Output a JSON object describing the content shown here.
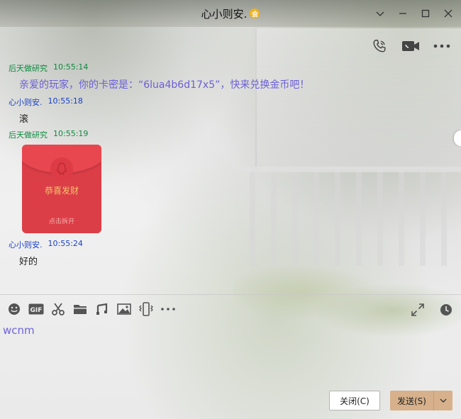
{
  "window": {
    "title": "心小则安.",
    "vip_badge": "会"
  },
  "messages": [
    {
      "sender": "后天做研究",
      "time": "10:55:14",
      "text": "亲爱的玩家，你的卡密是：“6lua4b6d17x5”，快来兑换金币吧！"
    },
    {
      "sender": "心小则安.",
      "time": "10:55:18",
      "text": "滚"
    },
    {
      "sender": "后天做研究",
      "time": "10:55:19",
      "red_packet": {
        "title": "恭喜发财",
        "action": "点击拆开"
      }
    },
    {
      "sender": "心小则安.",
      "time": "10:55:24",
      "text": "好的"
    }
  ],
  "input": {
    "value": "wcnm"
  },
  "buttons": {
    "close": "关闭(C)",
    "send": "发送(S)"
  },
  "icons": {
    "call": "phone-icon",
    "video": "video-icon",
    "more": "more-icon",
    "emoji": "emoji-icon",
    "gif": "gif-icon",
    "screenshot": "scissors-icon",
    "file": "folder-icon",
    "music": "music-icon",
    "image": "image-icon",
    "shake": "shake-icon",
    "tool_more": "more-icon",
    "expand": "expand-icon",
    "history": "clock-icon"
  },
  "gif_label": "GIF",
  "colors": {
    "other_sender": "#0b8a3e",
    "self_sender": "#1a3fc7",
    "first_message": "#6a5fd6",
    "red_packet": "#dc3e48",
    "send_button": "#d7b18b"
  }
}
